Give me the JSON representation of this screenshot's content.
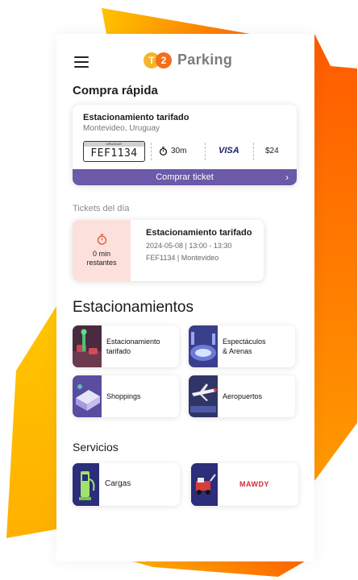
{
  "app": {
    "logo_badge_left": "T",
    "logo_badge_right": "2",
    "title": "Parking"
  },
  "quick_buy": {
    "section_title": "Compra rápida",
    "parking_name": "Estacionamiento tarifado",
    "location": "Montevideo, Uruguay",
    "plate_country": "URUGUAY",
    "plate_number": "FEF1134",
    "duration": "30m",
    "payment_brand": "VISA",
    "price": "$24",
    "buy_button": "Comprar ticket"
  },
  "tickets": {
    "section_title": "Tickets del día",
    "remaining_value": "0 min",
    "remaining_label": "restantes",
    "title": "Estacionamiento tarifado",
    "datetime": "2024-05-08 | 13:00 - 13:30",
    "plate_city": "FEF1134 | Montevideo"
  },
  "parkings": {
    "section_title": "Estacionamientos",
    "tiles": [
      {
        "line1": "Estacionamiento",
        "line2": "tarifado",
        "icon": "parking-meter-illustration"
      },
      {
        "line1": "Espectáculos",
        "line2": "& Arenas",
        "icon": "stadium-illustration"
      },
      {
        "line1": "Shoppings",
        "line2": "",
        "icon": "shopping-mall-illustration"
      },
      {
        "line1": "Aeropuertos",
        "line2": "",
        "icon": "airport-illustration"
      }
    ]
  },
  "services": {
    "section_title": "Servicios",
    "items": [
      {
        "label": "Cargas",
        "icon": "ev-charger-illustration"
      },
      {
        "label": "MAWDY",
        "icon": "tow-truck-illustration"
      }
    ]
  },
  "colors": {
    "accent_purple": "#6a5aa8",
    "brand_orange": "#f36f1c",
    "brand_yellow": "#f7b32b",
    "ticket_pink": "#fbe0dc"
  }
}
